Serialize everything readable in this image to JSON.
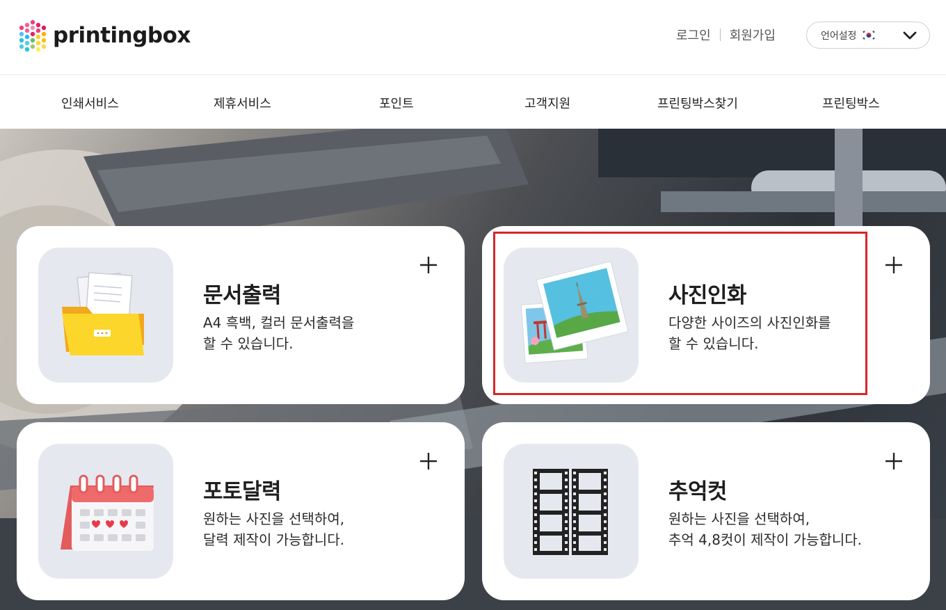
{
  "header": {
    "logo_text": "printingbox",
    "login": "로그인",
    "signup": "회원가입",
    "language_label": "언어설정",
    "language_flag": "korea-flag-icon"
  },
  "nav": {
    "items": [
      "인쇄서비스",
      "제휴서비스",
      "포인트",
      "고객지원",
      "프린팅박스찾기",
      "프린팅박스"
    ]
  },
  "services": [
    {
      "title": "문서출력",
      "desc_line1": "A4 흑백, 컬러 문서출력을",
      "desc_line2": "할 수 있습니다.",
      "icon": "folder-document-icon"
    },
    {
      "title": "사진인화",
      "desc_line1": "다양한 사이즈의 사진인화를",
      "desc_line2": "할 수 있습니다.",
      "icon": "photo-prints-icon",
      "highlighted": true
    },
    {
      "title": "포토달력",
      "desc_line1": "원하는 사진을 선택하여,",
      "desc_line2": "달력 제작이 가능합니다.",
      "icon": "calendar-icon"
    },
    {
      "title": "추억컷",
      "desc_line1": "원하는 사진을 선택하여,",
      "desc_line2": "추억 4,8컷이 제작이 가능합니다.",
      "icon": "film-strip-icon"
    }
  ],
  "colors": {
    "highlight": "#d7262b",
    "thumb_bg": "#e6e8f0"
  }
}
